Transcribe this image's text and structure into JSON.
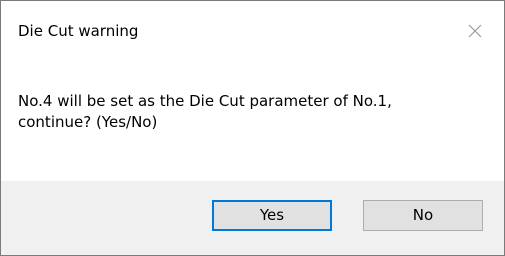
{
  "dialog": {
    "title": "Die Cut warning",
    "message": "No.4 will be set as the Die Cut parameter of No.1,\ncontinue? (Yes/No)",
    "close_icon": "close-icon",
    "buttons": {
      "yes_label": "Yes",
      "no_label": "No"
    }
  },
  "colors": {
    "background": "#ffffff",
    "button_bar": "#f0f0f0",
    "button_face": "#e1e1e1",
    "default_button_border": "#0078d7",
    "close_icon": "#9a9a9a"
  }
}
